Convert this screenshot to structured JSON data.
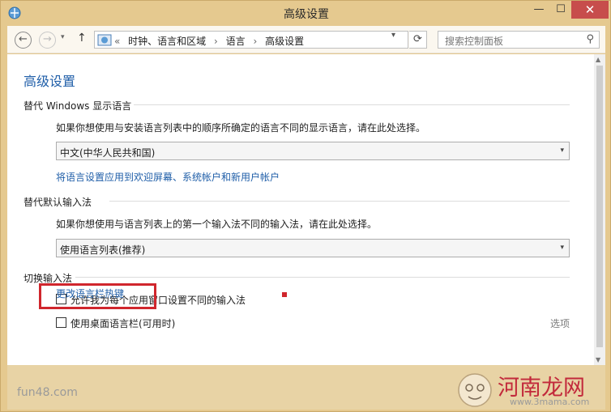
{
  "window": {
    "title": "高级设置",
    "controls": {
      "minimize": "—",
      "maximize": "☐",
      "close": "✕"
    }
  },
  "toolbar": {
    "back_glyph": "←",
    "forward_glyph": "→",
    "history_glyph": "▾",
    "up_glyph": "↑",
    "refresh_glyph": "⟳",
    "address_dropdown_glyph": "▾",
    "breadcrumb": [
      "«",
      "时钟、语言和区域",
      "›",
      "语言",
      "›",
      "高级设置"
    ],
    "search": {
      "placeholder": "搜索控制面板",
      "icon_glyph": "⚲"
    }
  },
  "content": {
    "page_title": "高级设置",
    "sections": [
      {
        "heading": "替代 Windows 显示语言",
        "description": "如果你想使用与安装语言列表中的顺序所确定的语言不同的显示语言，请在此处选择。",
        "select_value": "中文(中华人民共和国)",
        "link": "将语言设置应用到欢迎屏幕、系统帐户和新用户帐户"
      },
      {
        "heading": "替代默认输入法",
        "description": "如果你想使用与语言列表上的第一个输入法不同的输入法，请在此处选择。",
        "select_value": "使用语言列表(推荐)"
      },
      {
        "heading": "切换输入法",
        "checkbox_1": "允许我为每个应用窗口设置不同的输入法",
        "checkbox_2": "使用桌面语言栏(可用时)",
        "options_link": "选项",
        "hotkeys_link": "更改语言栏热键"
      }
    ],
    "select_arrow": "▾",
    "scroll_up": "▲",
    "scroll_down": "▼"
  },
  "watermarks": {
    "left": "fun48.com",
    "brand": "河南龙网",
    "brand_url": "www.3mama.com"
  },
  "colors": {
    "accent_blue": "#1f5ea8",
    "highlight_red": "#d0262d",
    "close_red": "#c74d4c",
    "frame": "#e5c98f"
  }
}
